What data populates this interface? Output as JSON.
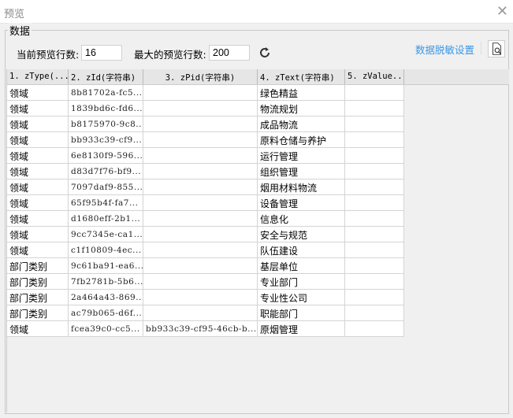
{
  "window": {
    "title": "预览",
    "close_icon": "close-icon"
  },
  "group": {
    "legend": "数据"
  },
  "toolbar": {
    "current_label": "当前预览行数:",
    "current_value": "16",
    "max_label": "最大的预览行数:",
    "max_value": "200",
    "mask_link": "数据脱敏设置"
  },
  "table": {
    "headers": [
      "1. zType(...",
      "2. zId(字符串)",
      "3. zPid(字符串)",
      "4. zText(字符串)",
      "5. zValue..."
    ],
    "rows": [
      [
        "领域",
        "8b81702a-fc5...",
        "",
        "绿色精益",
        ""
      ],
      [
        "领域",
        "1839bd6c-fd6...",
        "",
        "物流规划",
        ""
      ],
      [
        "领域",
        "b8175970-9c8...",
        "",
        "成品物流",
        ""
      ],
      [
        "领域",
        "bb933c39-cf9...",
        "",
        "原料仓储与养护",
        ""
      ],
      [
        "领域",
        "6e8130f9-596...",
        "",
        "运行管理",
        ""
      ],
      [
        "领域",
        "d83d7f76-bf9...",
        "",
        "组织管理",
        ""
      ],
      [
        "领域",
        "7097daf9-855...",
        "",
        "烟用材料物流",
        ""
      ],
      [
        "领域",
        "65f95b4f-fa7...",
        "",
        "设备管理",
        ""
      ],
      [
        "领域",
        "d1680eff-2b1...",
        "",
        "信息化",
        ""
      ],
      [
        "领域",
        "9cc7345e-ca1...",
        "",
        "安全与规范",
        ""
      ],
      [
        "领域",
        "c1f10809-4ec...",
        "",
        "队伍建设",
        ""
      ],
      [
        "部门类别",
        "9c61ba91-ea6...",
        "",
        "基层单位",
        ""
      ],
      [
        "部门类别",
        "7fb2781b-5b6...",
        "",
        "专业部门",
        ""
      ],
      [
        "部门类别",
        "2a464a43-869...",
        "",
        "专业性公司",
        ""
      ],
      [
        "部门类别",
        "ac79b065-d6f...",
        "",
        "职能部门",
        ""
      ],
      [
        "领域",
        "fcea39c0-cc5...",
        "bb933c39-cf95-46cb-b...",
        "原烟管理",
        ""
      ]
    ]
  }
}
